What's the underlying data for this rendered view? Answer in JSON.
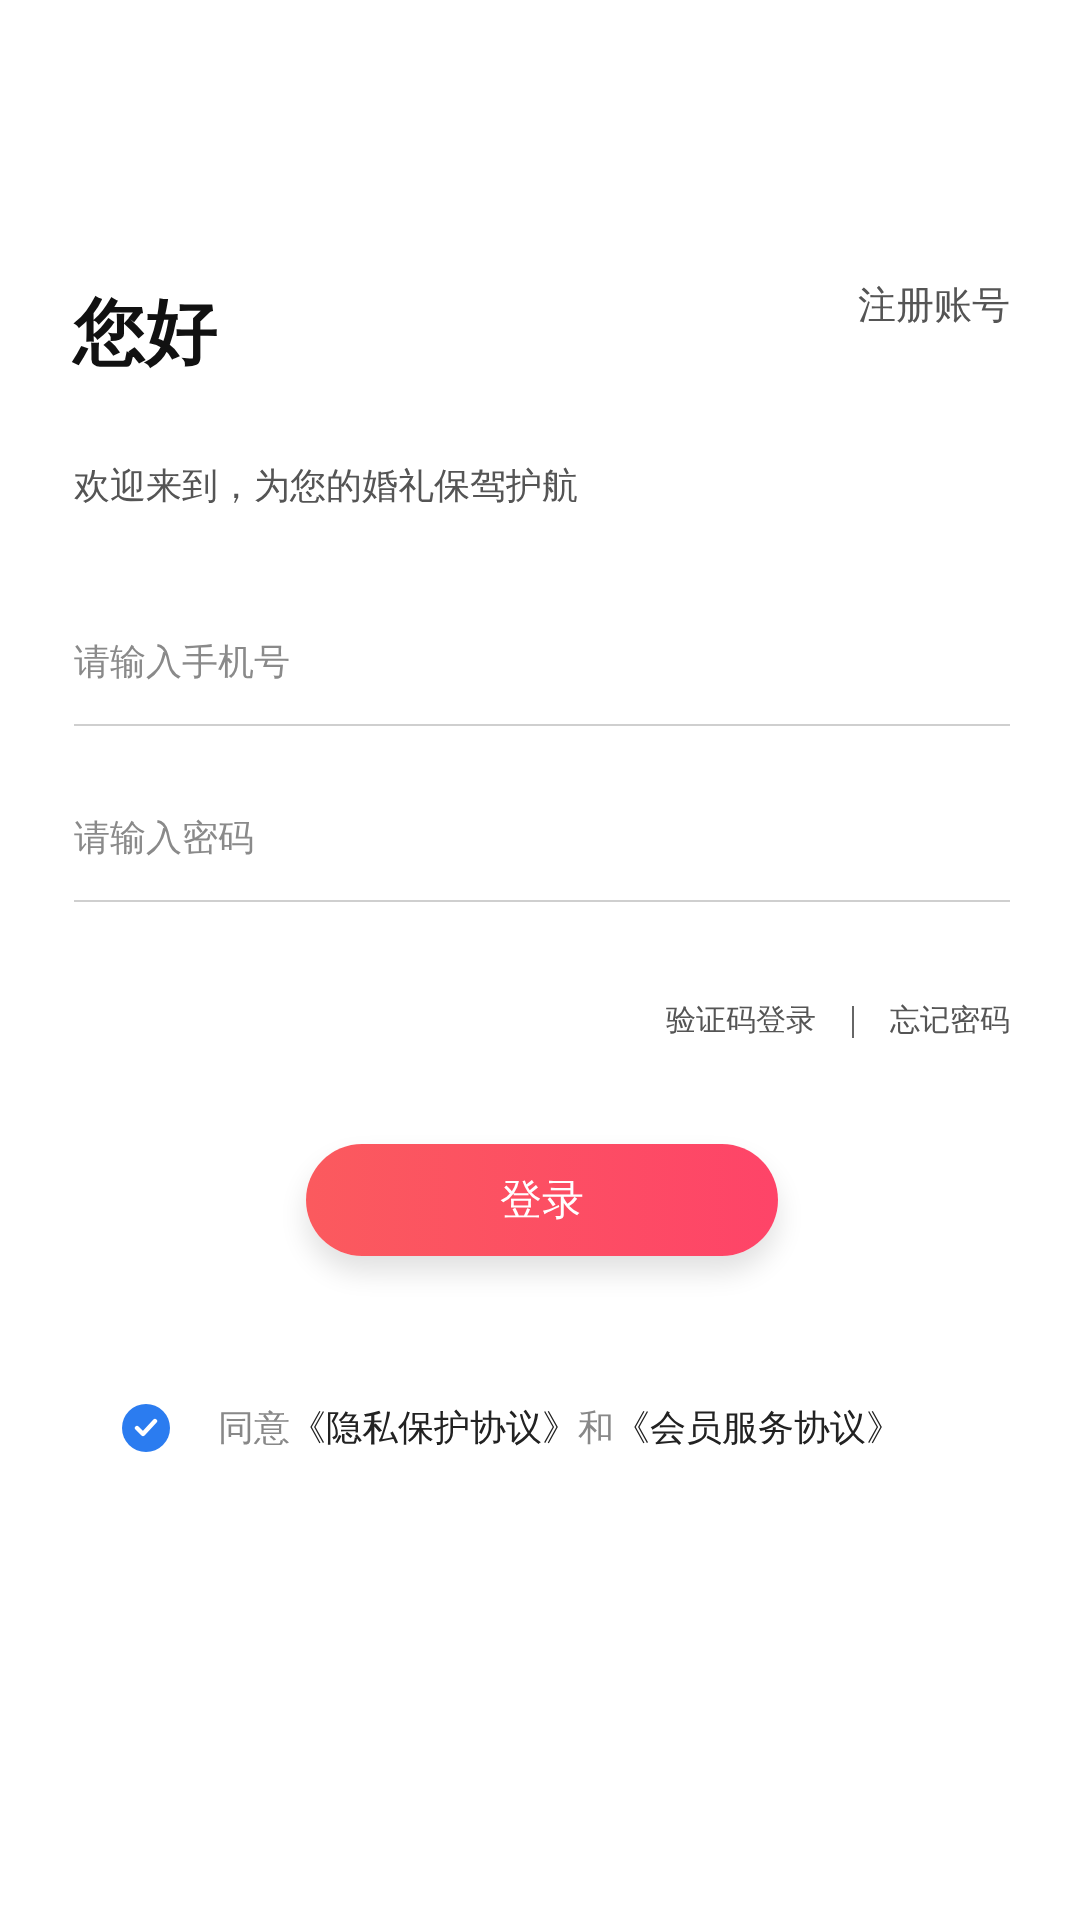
{
  "title": "您好",
  "register_link": "注册账号",
  "subtitle": "欢迎来到，为您的婚礼保驾护航",
  "fields": [
    {
      "placeholder": "请输入手机号"
    },
    {
      "placeholder": "请输入密码"
    }
  ],
  "links": [
    "验证码登录",
    "忘记密码"
  ],
  "login_button": "登录",
  "agreement": {
    "checked": true,
    "parts": [
      {
        "kind": "text",
        "text": "同意"
      },
      {
        "kind": "link",
        "text": "《隐私保护协议》"
      },
      {
        "kind": "text",
        "text": "和"
      },
      {
        "kind": "link",
        "text": "《会员服务协议》"
      }
    ]
  }
}
